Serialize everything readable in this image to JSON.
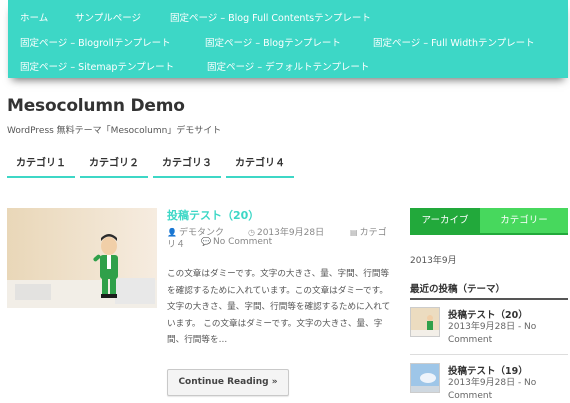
{
  "topnav": {
    "items": [
      "ホーム",
      "サンプルページ",
      "固定ページ – Blog Full Contentsテンプレート",
      "固定ページ – Blogrollテンプレート",
      "固定ページ – Blogテンプレート",
      "固定ページ – Full Widthテンプレート",
      "固定ページ – Sitemapテンプレート",
      "固定ページ – デフォルトテンプレート"
    ]
  },
  "header": {
    "title": "Mesocolumn Demo",
    "description": "WordPress 無料テーマ「Mesocolumn」デモサイト"
  },
  "categories": [
    "カテゴリ１",
    "カテゴリ２",
    "カテゴリ３",
    "カテゴリ４"
  ],
  "post": {
    "title": "投稿テスト（20）",
    "author": "デモタンク",
    "date": "2013年9月28日",
    "category_prefix": "カテゴ",
    "category_suffix": "リ４",
    "comments": "No Comment",
    "excerpt": "この文章はダミーです。文字の大きさ、量、字間、行間等を確認するために入れています。この文章はダミーです。文字の大きさ、量、字間、行間等を確認するために入れています。 この文章はダミーです。文字の大きさ、量、字間、行間等を…",
    "read_more": "Continue Reading »"
  },
  "sidebar": {
    "tabs": [
      "アーカイブ",
      "カテゴリー"
    ],
    "archive_item": "2013年9月",
    "recent_heading": "最近の投稿（テーマ）",
    "recent": [
      {
        "title": "投稿テスト（20）",
        "date": "2013年9月28日 - No",
        "comment": "Comment"
      },
      {
        "title": "投稿テスト（19）",
        "date": "2013年9月28日 - No",
        "comment": "Comment"
      }
    ]
  },
  "colors": {
    "accent": "#3dd7c6",
    "tab_dark": "#22a93b",
    "tab_light": "#47d85d"
  }
}
